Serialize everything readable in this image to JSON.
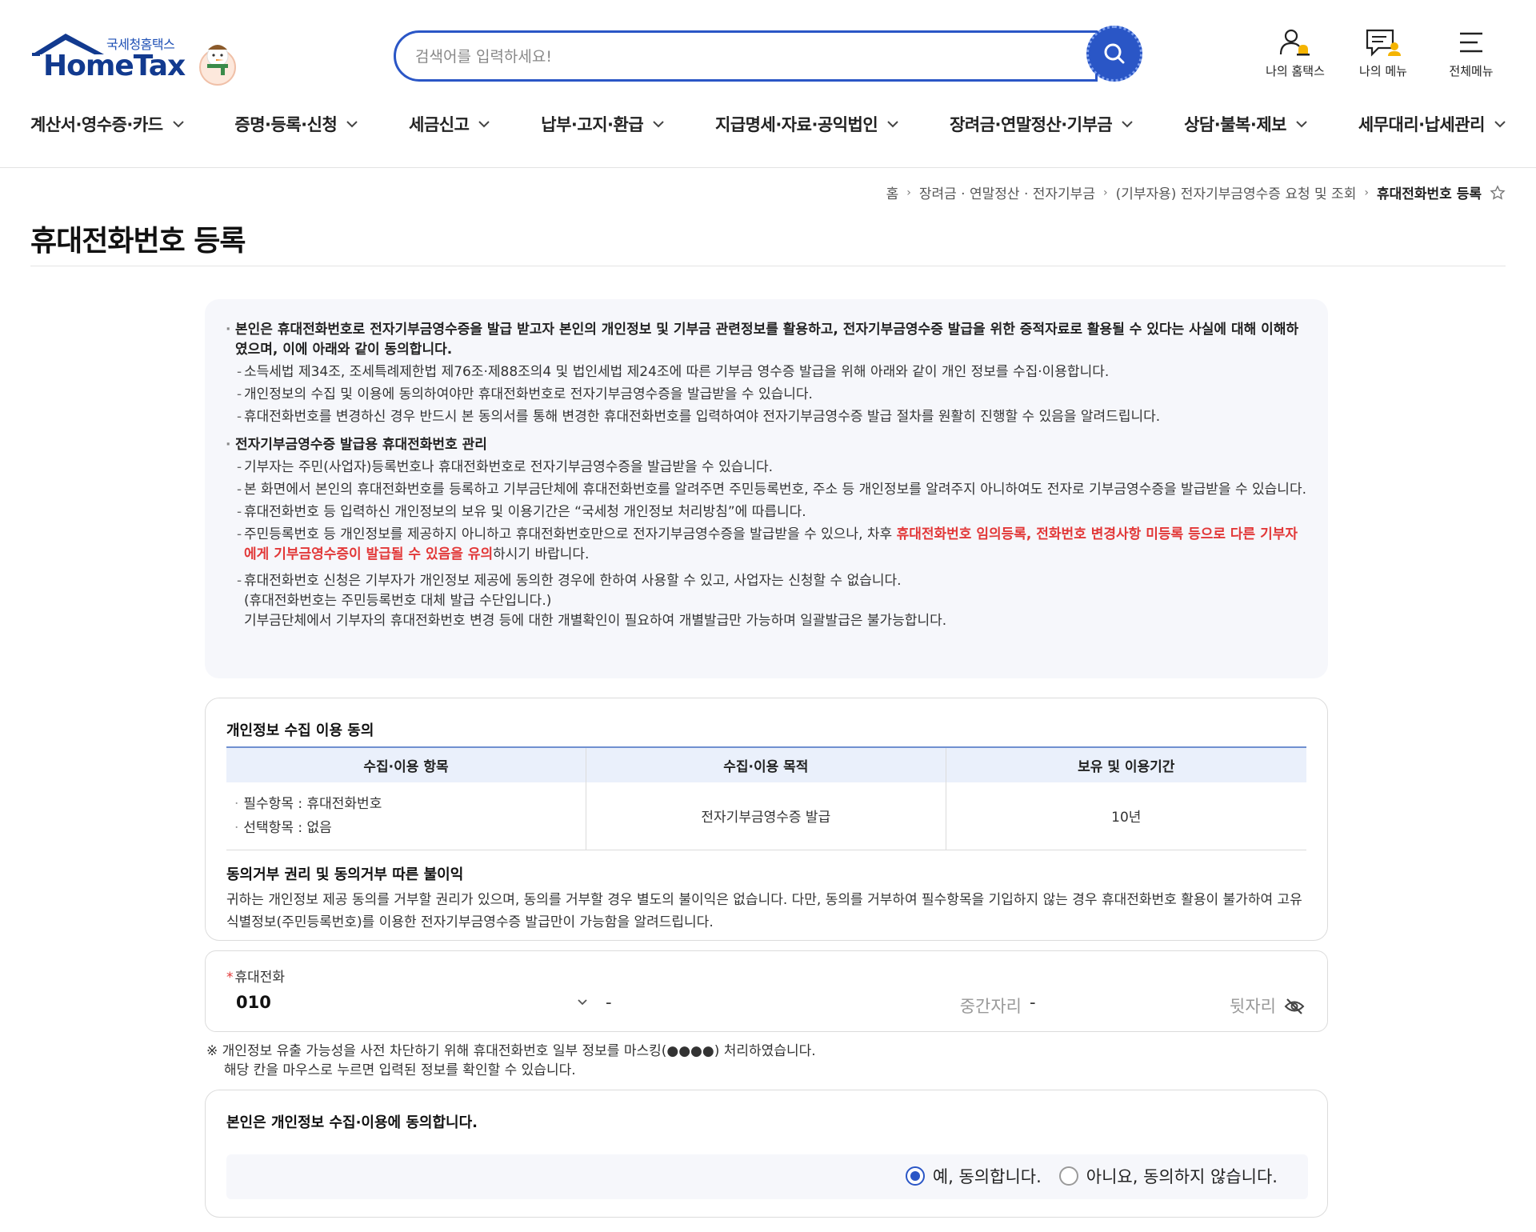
{
  "header": {
    "logo_sub": "국세청홈택스",
    "logo_main": "HomeTax",
    "search_placeholder": "검색어를 입력하세요!",
    "tools": [
      {
        "label": "나의 홈택스"
      },
      {
        "label": "나의 메뉴"
      },
      {
        "label": "전체메뉴"
      }
    ]
  },
  "gnb": [
    "계산서·영수증·카드",
    "증명·등록·신청",
    "세금신고",
    "납부·고지·환급",
    "지급명세·자료·공익법인",
    "장려금·연말정산·기부금",
    "상담·불복·제보",
    "세무대리·납세관리"
  ],
  "breadcrumb": {
    "items": [
      "홈",
      "장려금 · 연말정산 · 전자기부금",
      "(기부자용) 전자기부금영수증 요청 및 조회"
    ],
    "current": "휴대전화번호 등록"
  },
  "page": {
    "title": "휴대전화번호 등록"
  },
  "notice": {
    "b1": "본인은 휴대전화번호로 전자기부금영수증을 발급 받고자 본인의 개인정보 및 기부금 관련정보를 활용하고, 전자기부금영수증 발급을 위한 증적자료로 활용될 수 있다는 사실에 대해 이해하였으며, 이에 아래와 같이 동의합니다.",
    "b1_items": [
      "소득세법 제34조, 조세특례제한법 제76조·제88조의4 및 법인세법 제24조에 따른 기부금 영수증 발급을 위해 아래와 같이 개인 정보를 수집·이용합니다.",
      "개인정보의 수집 및 이용에 동의하여야만 휴대전화번호로 전자기부금영수증을 발급받을 수 있습니다.",
      "휴대전화번호를 변경하신 경우 반드시 본 동의서를 통해 변경한 휴대전화번호를 입력하여야 전자기부금영수증 발급 절차를 원활히 진행할 수 있음을 알려드립니다."
    ],
    "b2": "전자기부금영수증 발급용 휴대전화번호 관리",
    "b2_items": [
      "기부자는 주민(사업자)등록번호나 휴대전화번호로 전자기부금영수증을 발급받을 수 있습니다.",
      "본 화면에서 본인의 휴대전화번호를 등록하고 기부금단체에 휴대전화번호를 알려주면 주민등록번호, 주소 등 개인정보를 알려주지 아니하여도 전자로 기부금영수증을 발급받을 수 있습니다.",
      "휴대전화번호 등 입력하신 개인정보의 보유 및 이용기간은 “국세청 개인정보 처리방침”에 따릅니다."
    ],
    "b2_item4_pre": "주민등록번호 등 개인정보를 제공하지 아니하고 휴대전화번호만으로 전자기부금영수증을 발급받을 수 있으나, 차후 ",
    "b2_item4_red": "휴대전화번호 임의등록, 전화번호 변경사항 미등록 등으로 다른 기부자에게 기부금영수증이 발급될 수 있음을 유의",
    "b2_item4_post": "하시기 바랍니다.",
    "b2_item5": "휴대전화번호 신청은 기부자가 개인정보 제공에 동의한 경우에 한하여 사용할 수 있고, 사업자는 신청할 수 없습니다.",
    "b2_item5_l2": "(휴대전화번호는 주민등록번호 대체 발급 수단입니다.)",
    "b2_item5_l3": "기부금단체에서 기부자의 휴대전화번호 변경 등에 대한 개별확인이 필요하여 개별발급만 가능하며 일괄발급은 불가능합니다."
  },
  "privacy": {
    "title": "개인정보 수집 이용 동의",
    "columns": [
      "수집·이용 항목",
      "수집·이용 목적",
      "보유 및 이용기간"
    ],
    "items": [
      "필수항목 : 휴대전화번호",
      "선택항목 : 없음"
    ],
    "purpose": "전자기부금영수증 발급",
    "period": "10년",
    "refusal_title": "동의거부 권리 및 동의거부 따른 불이익",
    "refusal_text": "귀하는 개인정보 제공 동의를 거부할 권리가 있으며, 동의를 거부할 경우 별도의 불이익은 없습니다. 다만, 동의를 거부하여 필수항목을 기입하지 않는 경우 휴대전화번호 활용이 불가하여 고유식별정보(주민등록번호)를 이용한 전자기부금영수증 발급만이 가능함을 알려드립니다."
  },
  "phone": {
    "label": "휴대전화",
    "prefix": "010",
    "dash": "-",
    "middle_placeholder": "중간자리",
    "last_placeholder": "뒷자리"
  },
  "mask_note": {
    "line1": "※ 개인정보 유출 가능성을 사전 차단하기 위해 휴대전화번호 일부 정보를 마스킹(●●●●) 처리하였습니다.",
    "line2": "해당 칸을 마우스로 누르면 입력된 정보를 확인할 수 있습니다."
  },
  "agree": {
    "title": "본인은 개인정보 수집·이용에 동의합니다.",
    "yes": "예, 동의합니다.",
    "no": "아니요, 동의하지 않습니다."
  },
  "colors": {
    "brand_blue": "#2a56c6",
    "warning_red": "#e23838"
  }
}
